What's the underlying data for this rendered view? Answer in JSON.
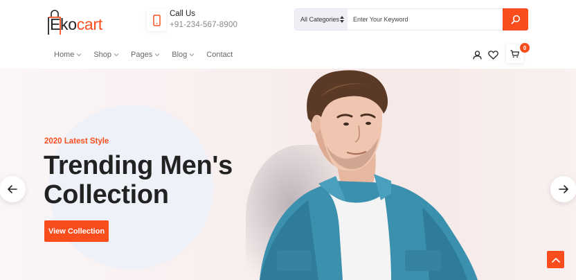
{
  "brand": {
    "logo_part1": "Eko",
    "logo_part2": "cart"
  },
  "contact": {
    "title": "Call Us",
    "phone": "+91-234-567-8900"
  },
  "search": {
    "category": "All Categories",
    "placeholder": "Enter Your Keyword"
  },
  "nav": {
    "items": [
      {
        "label": "Home"
      },
      {
        "label": "Shop"
      },
      {
        "label": "Pages"
      },
      {
        "label": "Blog"
      },
      {
        "label": "Contact"
      }
    ]
  },
  "cart": {
    "count": "0"
  },
  "hero": {
    "subtitle": "2020 Latest Style",
    "title_line1": "Trending Men's",
    "title_line2": "Collection",
    "button_label": "View Collection"
  },
  "colors": {
    "accent": "#fa4d1e",
    "text": "#222222",
    "muted": "#888888"
  },
  "icons": [
    "shopping-bag-icon",
    "phone-icon",
    "search-icon",
    "chevron-down-icon",
    "user-icon",
    "heart-icon",
    "cart-icon",
    "arrow-left-icon",
    "arrow-right-icon",
    "arrow-up-icon"
  ]
}
